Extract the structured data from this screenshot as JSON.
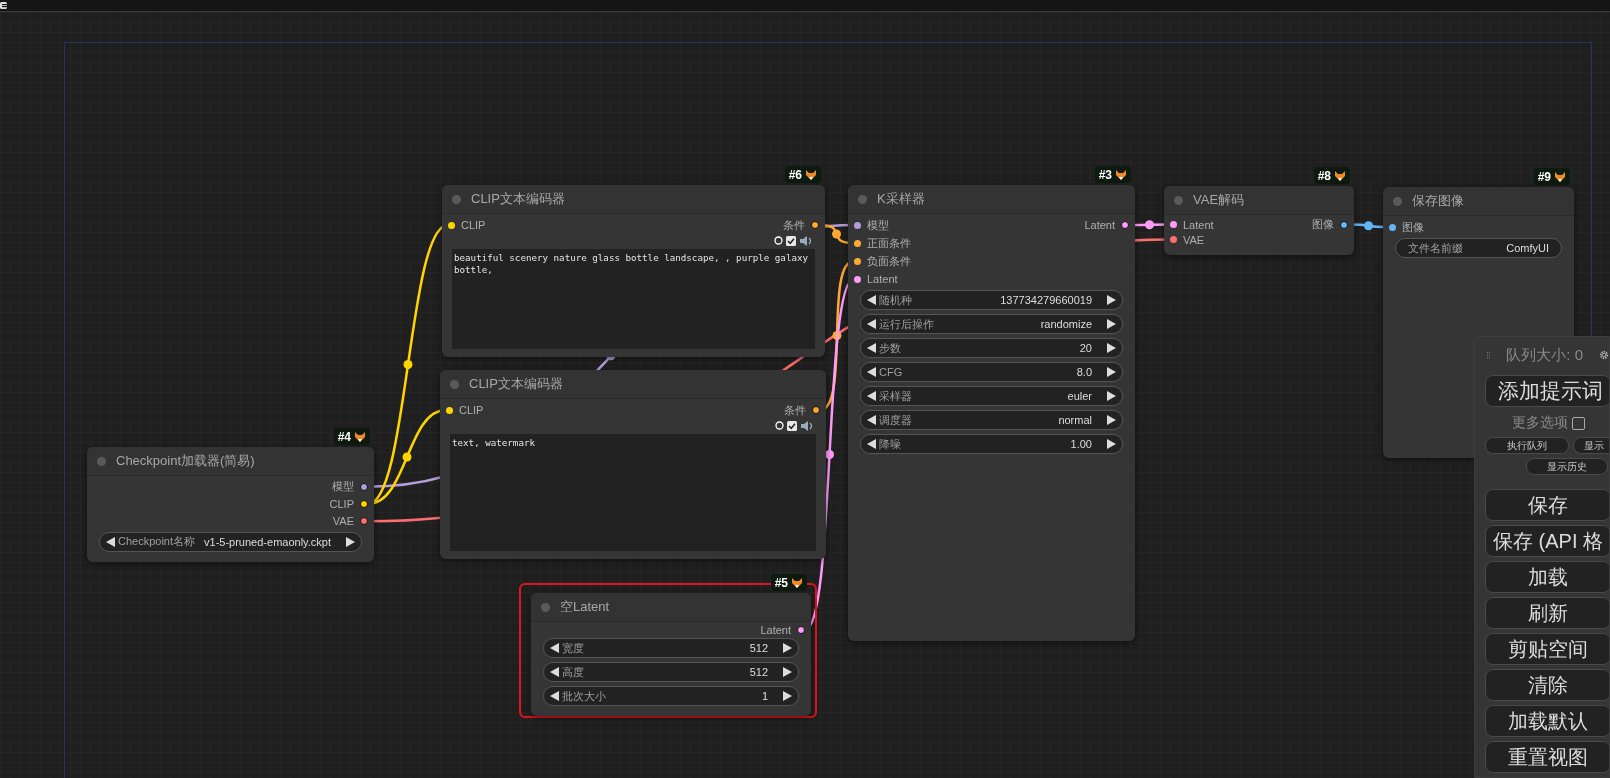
{
  "nodes": [
    {
      "badge": "#4",
      "title": "Checkpoint加载器(简易)",
      "selected": false,
      "outputs": [
        {
          "label": "模型",
          "color": "#b39ddb"
        },
        {
          "label": "CLIP",
          "color": "#ffd500"
        },
        {
          "label": "VAE",
          "color": "#ff6e6e"
        }
      ],
      "widgets": [
        {
          "kind": "stepper",
          "label": "Checkpoint名称",
          "value": "v1-5-pruned-emaonly.ckpt"
        }
      ]
    },
    {
      "badge": "#6",
      "title": "CLIP文本编码器",
      "selected": false,
      "inputs": [
        {
          "label": "CLIP",
          "color": "#ffd500"
        }
      ],
      "outputs": [
        {
          "label": "条件",
          "color": "#ffa931"
        }
      ],
      "toggles": {
        "checked": true
      },
      "prompt": "beautiful scenery nature glass bottle landscape, , purple galaxy bottle,"
    },
    {
      "title": "CLIP文本编码器",
      "selected": false,
      "inputs": [
        {
          "label": "CLIP",
          "color": "#ffd500"
        }
      ],
      "outputs": [
        {
          "label": "条件",
          "color": "#ffa931"
        }
      ],
      "toggles": {
        "checked": true
      },
      "prompt": "text, watermark"
    },
    {
      "badge": "#3",
      "title": "K采样器",
      "selected": false,
      "inputs": [
        {
          "label": "模型",
          "color": "#b39ddb"
        },
        {
          "label": "正面条件",
          "color": "#ffa931"
        },
        {
          "label": "负面条件",
          "color": "#ffa931"
        },
        {
          "label": "Latent",
          "color": "#ff9cf9"
        }
      ],
      "outputs": [
        {
          "label": "Latent",
          "color": "#ff9cf9"
        }
      ],
      "widgets": [
        {
          "kind": "stepper",
          "label": "随机种",
          "value": "137734279660019"
        },
        {
          "kind": "stepper",
          "label": "运行后操作",
          "value": "randomize"
        },
        {
          "kind": "stepper",
          "label": "步数",
          "value": "20"
        },
        {
          "kind": "stepper",
          "label": "CFG",
          "value": "8.0"
        },
        {
          "kind": "stepper",
          "label": "采样器",
          "value": "euler"
        },
        {
          "kind": "stepper",
          "label": "调度器",
          "value": "normal"
        },
        {
          "kind": "stepper",
          "label": "降噪",
          "value": "1.00"
        }
      ]
    },
    {
      "badge": "#8",
      "title": "VAE解码",
      "selected": false,
      "inputs": [
        {
          "label": "Latent",
          "color": "#ff9cf9"
        },
        {
          "label": "VAE",
          "color": "#ff6e6e"
        }
      ],
      "outputs": [
        {
          "label": "图像",
          "color": "#64b5f6"
        }
      ]
    },
    {
      "badge": "#9",
      "title": "保存图像",
      "selected": false,
      "inputs": [
        {
          "label": "图像",
          "color": "#64b5f6"
        }
      ],
      "widgets": [
        {
          "kind": "text",
          "label": "文件名前缀",
          "value": "ComfyUI"
        }
      ]
    },
    {
      "badge": "#5",
      "title": "空Latent",
      "selected": true,
      "outputs": [
        {
          "label": "Latent",
          "color": "#ff9cf9"
        }
      ],
      "widgets": [
        {
          "kind": "stepper",
          "label": "宽度",
          "value": "512"
        },
        {
          "kind": "stepper",
          "label": "高度",
          "value": "512"
        },
        {
          "kind": "stepper",
          "label": "批次大小",
          "value": "1"
        }
      ]
    }
  ],
  "queue_panel": {
    "title": "队列大小: 0",
    "primary_button": "添加提示词",
    "more_options": {
      "label": "更多选项",
      "checked": false
    },
    "small_buttons": [
      "执行队列",
      "显示"
    ],
    "history_button": "显示历史",
    "buttons": [
      "保存",
      "保存 (API 格",
      "加载",
      "刷新",
      "剪贴空间",
      "清除",
      "加载默认",
      "重置视图"
    ]
  }
}
